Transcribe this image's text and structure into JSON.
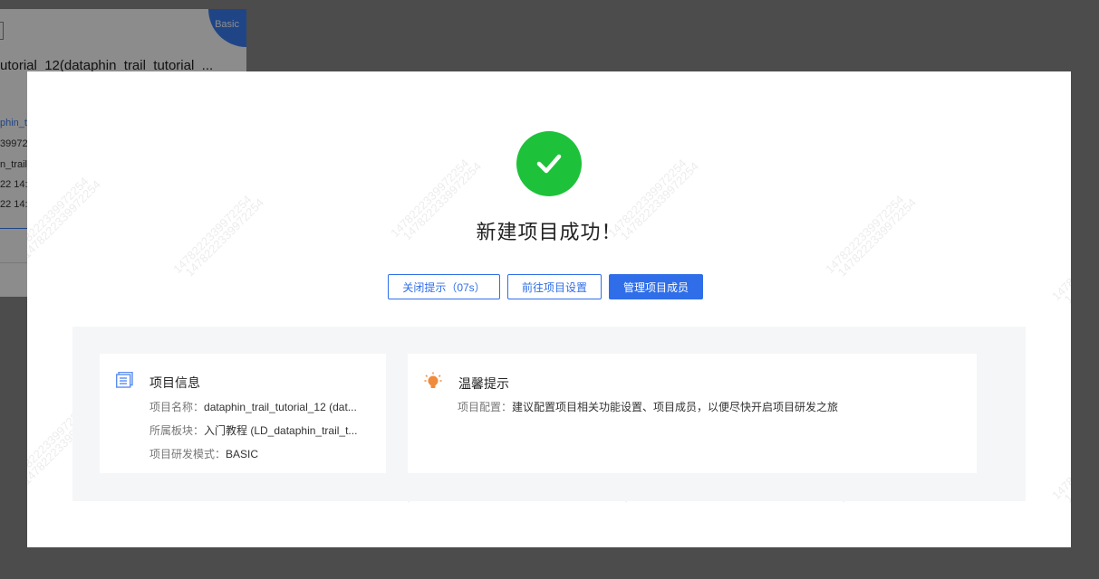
{
  "background_card": {
    "badge": "Basic",
    "title": "utorial_12(dataphin_trail_tutorial_...",
    "lines": [
      {
        "text": "phin_tu",
        "link": true
      },
      {
        "text": "39972",
        "link": false
      },
      {
        "text": "n_trail_",
        "link": false
      },
      {
        "text": "22 14:",
        "link": false
      },
      {
        "text": "22 14:",
        "link": false
      }
    ]
  },
  "watermark_text": "1478222339972254",
  "modal": {
    "title": "新建项目成功！",
    "buttons": {
      "close": "关闭提示（07s）",
      "settings": "前往项目设置",
      "manage": "管理项目成员"
    },
    "info_card": {
      "title": "项目信息",
      "rows": [
        {
          "label": "项目名称：",
          "value": "dataphin_trail_tutorial_12 (dat..."
        },
        {
          "label": "所属板块：",
          "value": "入门教程 (LD_dataphin_trail_t..."
        },
        {
          "label": "项目研发模式：",
          "value": "BASIC"
        }
      ]
    },
    "tip_card": {
      "title": "温馨提示",
      "label": "项目配置：",
      "text": "建议配置项目相关功能设置、项目成员，以便尽快开启项目研发之旅"
    }
  },
  "colors": {
    "success": "#1ec23a",
    "primary": "#2f6ee8",
    "tip_icon": "#f08a3c",
    "info_icon": "#5b8def"
  }
}
